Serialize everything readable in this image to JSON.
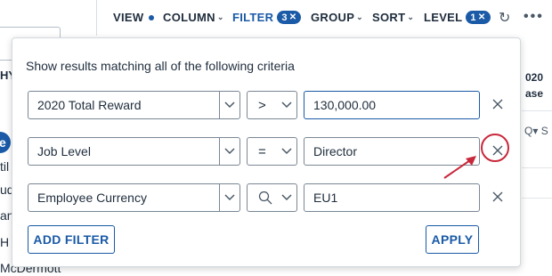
{
  "background": {
    "left_header_fragment": "HY",
    "selected_row_fragment": "e",
    "left_rows": [
      "til",
      "ud",
      "an",
      "H",
      "McDermott"
    ],
    "right_header_fragment_1": "020",
    "right_header_fragment_2": "ase",
    "right_icons": "Q▾ S"
  },
  "toolbar": {
    "view": "VIEW",
    "column": "COLUMN",
    "filter": "FILTER",
    "filter_count": "3",
    "group": "GROUP",
    "sort": "SORT",
    "level": "LEVEL",
    "level_count": "1",
    "refresh_icon": "refresh-icon",
    "more_icon": "more-icon"
  },
  "popup": {
    "title": "Show results matching all of the following criteria",
    "rows": [
      {
        "attribute": "2020 Total Reward",
        "operator": ">",
        "value": "130,000.00"
      },
      {
        "attribute": "Job Level",
        "operator": "=",
        "value": "Director"
      },
      {
        "attribute": "Employee Currency",
        "operator": "search",
        "value": "EU1"
      }
    ],
    "add_filter_label": "ADD FILTER",
    "apply_label": "APPLY"
  },
  "colors": {
    "accent": "#1a5aa6",
    "annotation": "#c8283b",
    "text": "#1f2d3d"
  }
}
